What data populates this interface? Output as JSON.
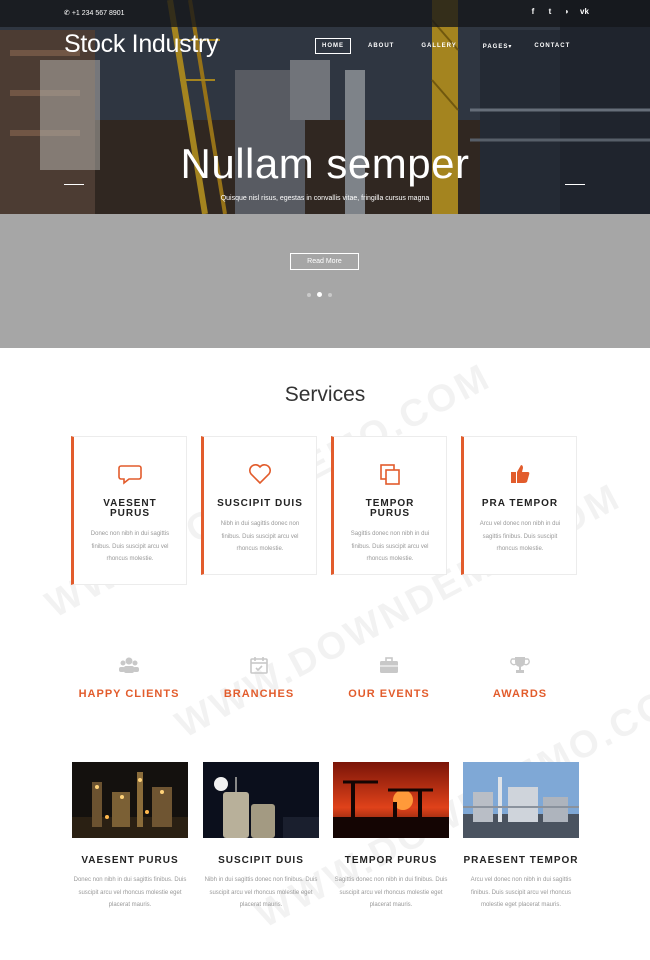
{
  "topbar": {
    "phone": "+1 234 567 8901",
    "social": [
      "facebook-icon",
      "twitter-icon",
      "rss-icon",
      "vk-icon"
    ]
  },
  "brand": {
    "logo": "Stock Industry"
  },
  "nav": {
    "home": "HOME",
    "about": "ABOUT",
    "gallery": "GALLERY",
    "pages": "PAGES",
    "contact": "CONTACT"
  },
  "hero": {
    "title": "Nullam semper",
    "subtitle": "Quisque nisl risus, egestas in convallis vitae, fringilla cursus magna",
    "button": "Read More",
    "slides": 3,
    "active_slide": 2
  },
  "services": {
    "heading": "Services",
    "items": [
      {
        "icon": "chat-bubble-icon",
        "title": "VAESENT PURUS",
        "text": "Donec non nibh in dui sagittis finibus. Duis suscipit arcu vel rhoncus molestie."
      },
      {
        "icon": "heart-icon",
        "title": "SUSCIPIT DUIS",
        "text": "Nibh in dui sagittis donec non finibus. Duis suscipit arcu vel rhoncus molestie."
      },
      {
        "icon": "copy-icon",
        "title": "TEMPOR PURUS",
        "text": "Sagittis donec non nibh in dui finibus. Duis suscipit arcu vel rhoncus molestie."
      },
      {
        "icon": "thumbs-up-icon",
        "title": "PRA TEMPOR",
        "text": "Arcu vel donec non nibh in dui sagittis finibus. Duis suscipit rhoncus molestie."
      }
    ]
  },
  "stats": [
    {
      "icon": "users-icon",
      "label": "HAPPY CLIENTS"
    },
    {
      "icon": "calendar-icon",
      "label": "BRANCHES"
    },
    {
      "icon": "briefcase-icon",
      "label": "OUR EVENTS"
    },
    {
      "icon": "trophy-icon",
      "label": "AWARDS"
    }
  ],
  "projects": [
    {
      "title": "VAESENT PURUS",
      "text": "Donec non nibh in dui sagittis finibus. Duis suscipit arcu vel rhoncus molestie eget placerat mauris."
    },
    {
      "title": "SUSCIPIT DUIS",
      "text": "Nibh in dui sagittis donec non finibus. Duis suscipit arcu vel rhoncus molestie eget placerat mauris."
    },
    {
      "title": "TEMPOR PURUS",
      "text": "Sagittis donec non nibh in dui finibus. Duis suscipit arcu vel rhoncus molestie eget placerat mauris."
    },
    {
      "title": "PRAESENT TEMPOR",
      "text": "Arcu vel donec non nibh in dui sagittis finibus. Duis suscipit arcu vel rhoncus molestie eget placerat mauris."
    }
  ],
  "watermark": "WWW.DOWNDEMO.COM",
  "colors": {
    "accent": "#e25c2c",
    "grey_band": "#a6a6a6"
  }
}
